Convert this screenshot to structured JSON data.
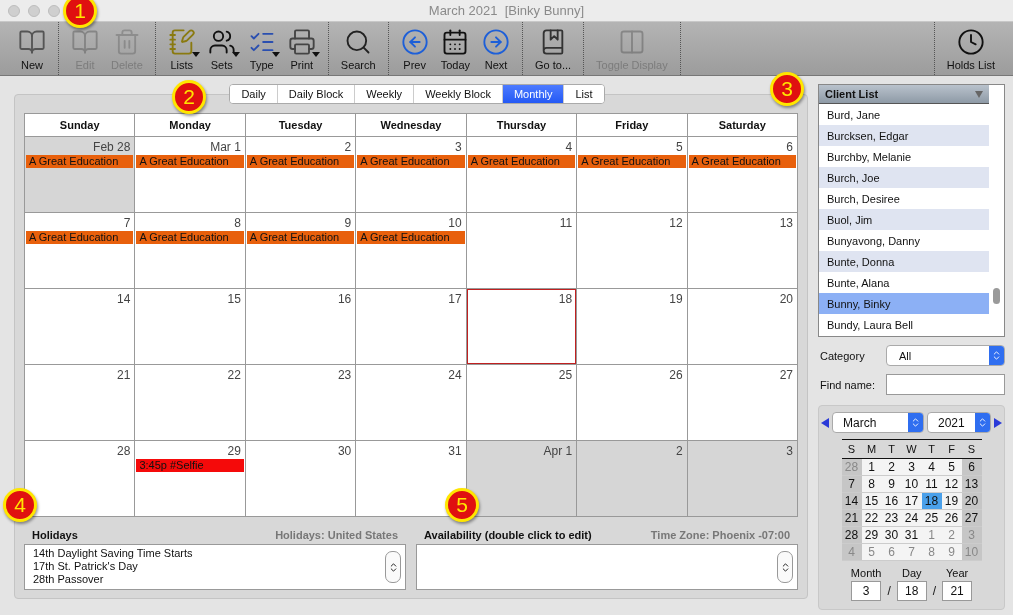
{
  "window": {
    "title": "March 2021  [Binky Bunny]"
  },
  "toolbar": {
    "left_groups": [
      [
        {
          "label": "New",
          "kind": "new",
          "disabled": false,
          "menu": false
        }
      ],
      [
        {
          "label": "Edit",
          "kind": "edit",
          "disabled": true,
          "menu": false
        },
        {
          "label": "Delete",
          "kind": "delete",
          "disabled": true,
          "menu": false
        }
      ],
      [
        {
          "label": "Lists",
          "kind": "lists",
          "disabled": false,
          "menu": true
        },
        {
          "label": "Sets",
          "kind": "sets",
          "disabled": false,
          "menu": true
        },
        {
          "label": "Type",
          "kind": "type",
          "disabled": false,
          "menu": true
        },
        {
          "label": "Print",
          "kind": "print",
          "disabled": false,
          "menu": true
        }
      ],
      [
        {
          "label": "Search",
          "kind": "search",
          "disabled": false,
          "menu": false
        }
      ],
      [
        {
          "label": "Prev",
          "kind": "prev",
          "disabled": false,
          "menu": false
        },
        {
          "label": "Today",
          "kind": "today",
          "disabled": false,
          "menu": false
        },
        {
          "label": "Next",
          "kind": "next",
          "disabled": false,
          "menu": false
        }
      ],
      [
        {
          "label": "Go to...",
          "kind": "goto",
          "disabled": false,
          "menu": false
        }
      ],
      [
        {
          "label": "Toggle Display",
          "kind": "toggle",
          "disabled": true,
          "menu": false
        }
      ]
    ],
    "right_groups": [
      [
        {
          "label": "Holds List",
          "kind": "holds",
          "disabled": false,
          "menu": false
        }
      ]
    ]
  },
  "view_tabs": [
    {
      "label": "Daily",
      "selected": false
    },
    {
      "label": "Daily Block",
      "selected": false
    },
    {
      "label": "Weekly",
      "selected": false
    },
    {
      "label": "Weekly Block",
      "selected": false
    },
    {
      "label": "Monthly",
      "selected": true
    },
    {
      "label": "List",
      "selected": false
    }
  ],
  "calendar": {
    "weekdays": [
      "Sunday",
      "Monday",
      "Tuesday",
      "Wednesday",
      "Thursday",
      "Friday",
      "Saturday"
    ],
    "weeks": [
      [
        {
          "label": "Feb 28",
          "other_month": true,
          "today": false,
          "events": [
            {
              "text": "A Great Education",
              "color": "#e8600c"
            }
          ]
        },
        {
          "label": "Mar 1",
          "other_month": false,
          "today": false,
          "events": [
            {
              "text": "A Great Education",
              "color": "#e8600c"
            }
          ]
        },
        {
          "label": "2",
          "other_month": false,
          "today": false,
          "events": [
            {
              "text": "A Great Education",
              "color": "#e8600c"
            }
          ]
        },
        {
          "label": "3",
          "other_month": false,
          "today": false,
          "events": [
            {
              "text": "A Great Education",
              "color": "#e8600c"
            }
          ]
        },
        {
          "label": "4",
          "other_month": false,
          "today": false,
          "events": [
            {
              "text": "A Great Education",
              "color": "#e8600c"
            }
          ]
        },
        {
          "label": "5",
          "other_month": false,
          "today": false,
          "events": [
            {
              "text": "A Great Education",
              "color": "#e8600c"
            }
          ]
        },
        {
          "label": "6",
          "other_month": false,
          "today": false,
          "events": [
            {
              "text": "A Great Education",
              "color": "#e8600c"
            }
          ]
        }
      ],
      [
        {
          "label": "7",
          "other_month": false,
          "today": false,
          "events": [
            {
              "text": "A Great Education",
              "color": "#e8600c"
            }
          ]
        },
        {
          "label": "8",
          "other_month": false,
          "today": false,
          "events": [
            {
              "text": "A Great Education",
              "color": "#e8600c"
            }
          ]
        },
        {
          "label": "9",
          "other_month": false,
          "today": false,
          "events": [
            {
              "text": "A Great Education",
              "color": "#e8600c"
            }
          ]
        },
        {
          "label": "10",
          "other_month": false,
          "today": false,
          "events": [
            {
              "text": "A Great Education",
              "color": "#e8600c"
            }
          ]
        },
        {
          "label": "11",
          "other_month": false,
          "today": false
        },
        {
          "label": "12",
          "other_month": false,
          "today": false
        },
        {
          "label": "13",
          "other_month": false,
          "today": false
        }
      ],
      [
        {
          "label": "14",
          "other_month": false,
          "today": false
        },
        {
          "label": "15",
          "other_month": false,
          "today": false
        },
        {
          "label": "16",
          "other_month": false,
          "today": false
        },
        {
          "label": "17",
          "other_month": false,
          "today": false
        },
        {
          "label": "18",
          "other_month": false,
          "today": true
        },
        {
          "label": "19",
          "other_month": false,
          "today": false
        },
        {
          "label": "20",
          "other_month": false,
          "today": false
        }
      ],
      [
        {
          "label": "21",
          "other_month": false,
          "today": false
        },
        {
          "label": "22",
          "other_month": false,
          "today": false
        },
        {
          "label": "23",
          "other_month": false,
          "today": false
        },
        {
          "label": "24",
          "other_month": false,
          "today": false
        },
        {
          "label": "25",
          "other_month": false,
          "today": false
        },
        {
          "label": "26",
          "other_month": false,
          "today": false
        },
        {
          "label": "27",
          "other_month": false,
          "today": false
        }
      ],
      [
        {
          "label": "28",
          "other_month": false,
          "today": false
        },
        {
          "label": "29",
          "other_month": false,
          "today": false,
          "events": [
            {
              "text": "3:45p #Selfie",
              "color": "#f50a0a"
            }
          ]
        },
        {
          "label": "30",
          "other_month": false,
          "today": false
        },
        {
          "label": "31",
          "other_month": false,
          "today": false
        },
        {
          "label": "Apr 1",
          "other_month": true,
          "today": false
        },
        {
          "label": "2",
          "other_month": true,
          "today": false
        },
        {
          "label": "3",
          "other_month": true,
          "today": false
        }
      ]
    ]
  },
  "holidays": {
    "title": "Holidays",
    "region": "Holidays: United States",
    "items": [
      "14th Daylight Saving Time Starts",
      "17th St. Patrick's Day",
      "28th Passover"
    ]
  },
  "availability": {
    "title": "Availability (double click to edit)",
    "time_zone": "Time Zone: Phoenix -07:00"
  },
  "client_list": {
    "title": "Client List",
    "items": [
      {
        "name": "Burd, Jane",
        "selected": false
      },
      {
        "name": "Burcksen, Edgar",
        "selected": false
      },
      {
        "name": "Burchby, Melanie",
        "selected": false
      },
      {
        "name": "Burch, Joe",
        "selected": false
      },
      {
        "name": "Burch, Desiree",
        "selected": false
      },
      {
        "name": "Buol, Jim",
        "selected": false
      },
      {
        "name": "Bunyavong, Danny",
        "selected": false
      },
      {
        "name": "Bunte, Donna",
        "selected": false
      },
      {
        "name": "Bunte, Alana",
        "selected": false
      },
      {
        "name": "Bunny, Binky",
        "selected": true
      },
      {
        "name": "Bundy, Laura Bell",
        "selected": false
      }
    ]
  },
  "category": {
    "label": "Category",
    "value": "All"
  },
  "find_name": {
    "label": "Find name:"
  },
  "mini_calendar": {
    "month": "March",
    "year": "2021",
    "weekdays": [
      "S",
      "M",
      "T",
      "W",
      "T",
      "F",
      "S"
    ],
    "weeks": [
      [
        {
          "label": "28",
          "other_month": true,
          "selected": false
        },
        {
          "label": "1",
          "other_month": false,
          "selected": false
        },
        {
          "label": "2",
          "other_month": false,
          "selected": false
        },
        {
          "label": "3",
          "other_month": false,
          "selected": false
        },
        {
          "label": "4",
          "other_month": false,
          "selected": false
        },
        {
          "label": "5",
          "other_month": false,
          "selected": false
        },
        {
          "label": "6",
          "other_month": false,
          "selected": false
        }
      ],
      [
        {
          "label": "7",
          "other_month": false,
          "selected": false
        },
        {
          "label": "8",
          "other_month": false,
          "selected": false
        },
        {
          "label": "9",
          "other_month": false,
          "selected": false
        },
        {
          "label": "10",
          "other_month": false,
          "selected": false
        },
        {
          "label": "11",
          "other_month": false,
          "selected": false
        },
        {
          "label": "12",
          "other_month": false,
          "selected": false
        },
        {
          "label": "13",
          "other_month": false,
          "selected": false
        }
      ],
      [
        {
          "label": "14",
          "other_month": false,
          "selected": false
        },
        {
          "label": "15",
          "other_month": false,
          "selected": false
        },
        {
          "label": "16",
          "other_month": false,
          "selected": false
        },
        {
          "label": "17",
          "other_month": false,
          "selected": false
        },
        {
          "label": "18",
          "other_month": false,
          "selected": true
        },
        {
          "label": "19",
          "other_month": false,
          "selected": false
        },
        {
          "label": "20",
          "other_month": false,
          "selected": false
        }
      ],
      [
        {
          "label": "21",
          "other_month": false,
          "selected": false
        },
        {
          "label": "22",
          "other_month": false,
          "selected": false
        },
        {
          "label": "23",
          "other_month": false,
          "selected": false
        },
        {
          "label": "24",
          "other_month": false,
          "selected": false
        },
        {
          "label": "25",
          "other_month": false,
          "selected": false
        },
        {
          "label": "26",
          "other_month": false,
          "selected": false
        },
        {
          "label": "27",
          "other_month": false,
          "selected": false
        }
      ],
      [
        {
          "label": "28",
          "other_month": false,
          "selected": false
        },
        {
          "label": "29",
          "other_month": false,
          "selected": false
        },
        {
          "label": "30",
          "other_month": false,
          "selected": false
        },
        {
          "label": "31",
          "other_month": false,
          "selected": false
        },
        {
          "label": "1",
          "other_month": true,
          "selected": false
        },
        {
          "label": "2",
          "other_month": true,
          "selected": false
        },
        {
          "label": "3",
          "other_month": true,
          "selected": false
        }
      ],
      [
        {
          "label": "4",
          "other_month": true,
          "selected": false
        },
        {
          "label": "5",
          "other_month": true,
          "selected": false
        },
        {
          "label": "6",
          "other_month": true,
          "selected": false
        },
        {
          "label": "7",
          "other_month": true,
          "selected": false
        },
        {
          "label": "8",
          "other_month": true,
          "selected": false
        },
        {
          "label": "9",
          "other_month": true,
          "selected": false
        },
        {
          "label": "10",
          "other_month": true,
          "selected": false
        }
      ]
    ],
    "fields": [
      {
        "label": "Month",
        "value": "3"
      },
      {
        "label": "Day",
        "value": "18"
      },
      {
        "label": "Year",
        "value": "21"
      }
    ],
    "separators": [
      "/",
      "/"
    ]
  },
  "callouts": [
    "1",
    "2",
    "3",
    "4",
    "5"
  ]
}
